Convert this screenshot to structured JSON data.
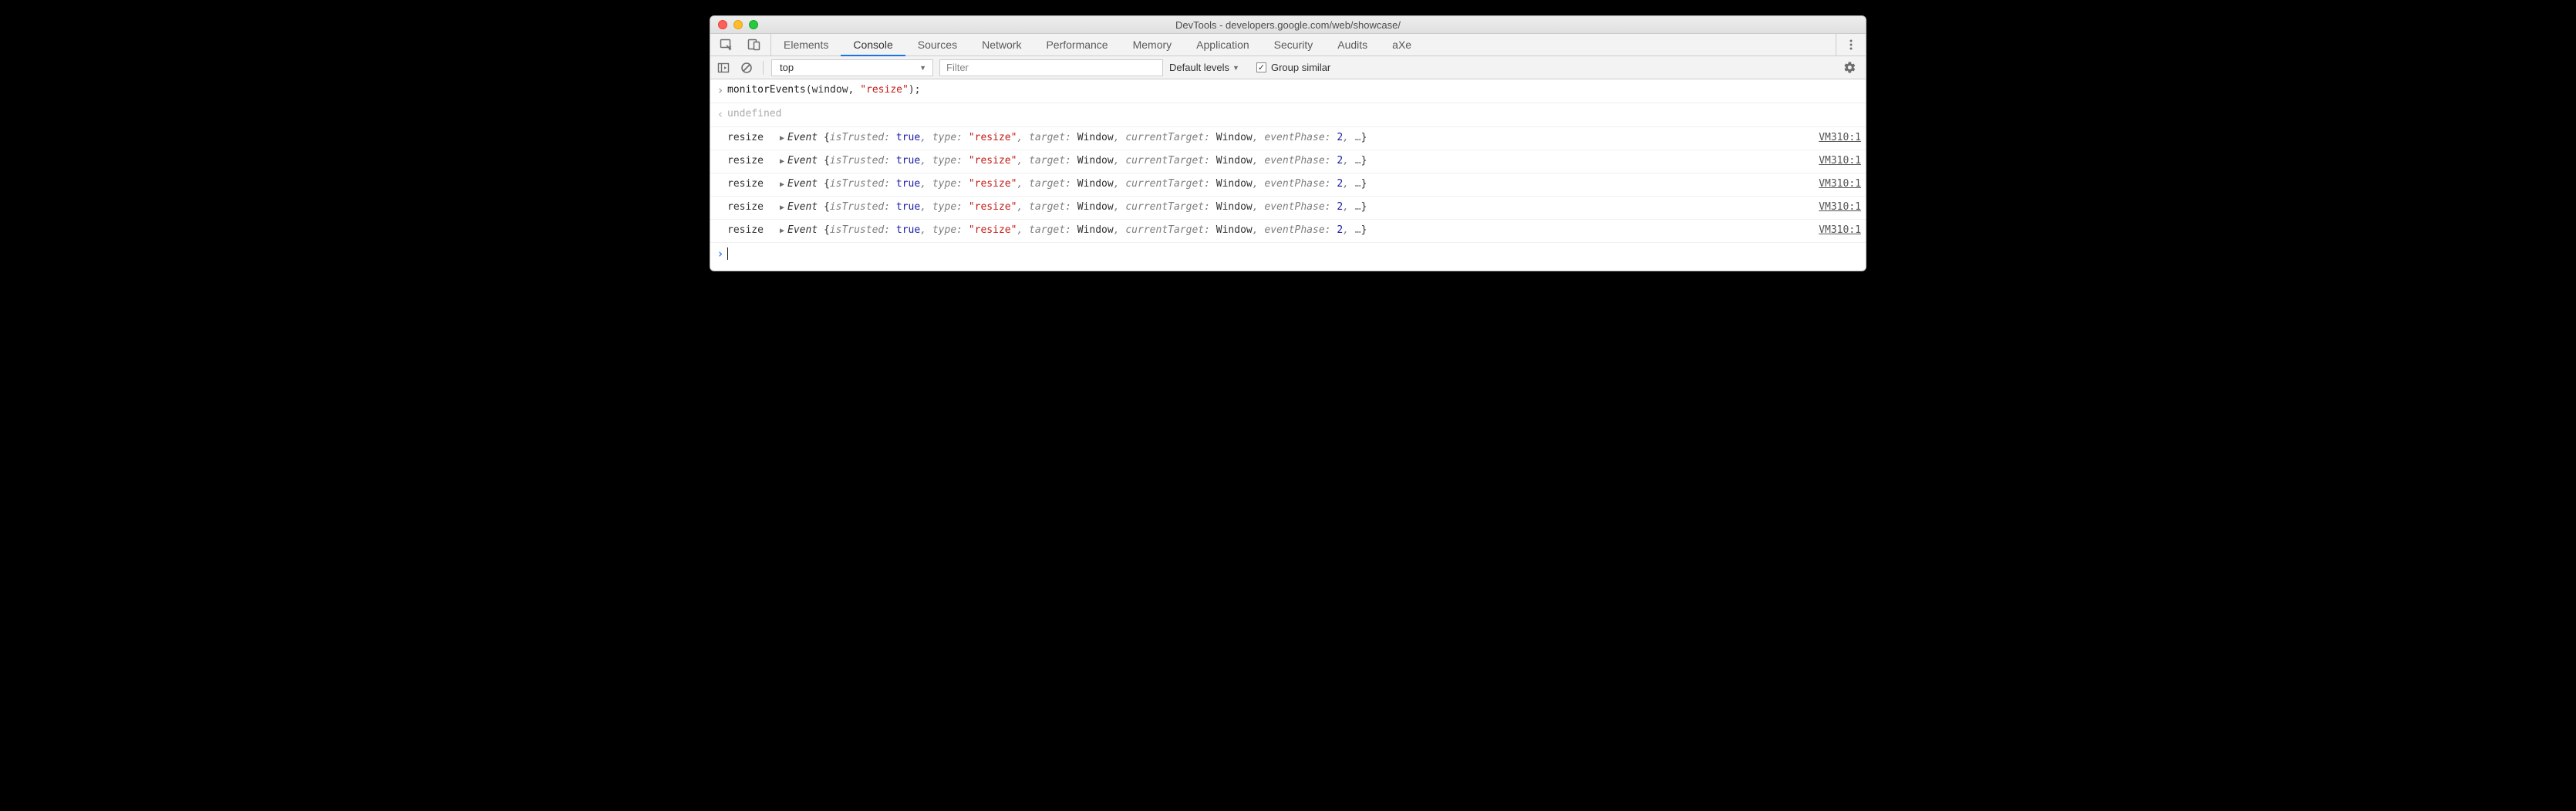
{
  "window": {
    "title": "DevTools - developers.google.com/web/showcase/"
  },
  "tabs": {
    "items": [
      {
        "label": "Elements"
      },
      {
        "label": "Console"
      },
      {
        "label": "Sources"
      },
      {
        "label": "Network"
      },
      {
        "label": "Performance"
      },
      {
        "label": "Memory"
      },
      {
        "label": "Application"
      },
      {
        "label": "Security"
      },
      {
        "label": "Audits"
      },
      {
        "label": "aXe"
      }
    ],
    "activeIndex": 1
  },
  "toolbar": {
    "context": "top",
    "filterPlaceholder": "Filter",
    "levelsLabel": "Default levels",
    "groupSimilarLabel": "Group similar",
    "groupSimilarChecked": true
  },
  "console": {
    "inputLine": {
      "fn": "monitorEvents",
      "open": "(window, ",
      "str": "\"resize\"",
      "close": ");"
    },
    "outputLine": "undefined",
    "events": [
      {
        "name": "resize",
        "objName": "Event",
        "props": {
          "isTrustedLabel": "isTrusted:",
          "isTrustedVal": "true",
          "typeLabel": "type:",
          "typeVal": "\"resize\"",
          "targetLabel": "target:",
          "targetVal": "Window",
          "curTargetLabel": "currentTarget:",
          "curTargetVal": "Window",
          "phaseLabel": "eventPhase:",
          "phaseVal": "2"
        },
        "source": "VM310:1"
      },
      {
        "name": "resize",
        "objName": "Event",
        "props": {
          "isTrustedLabel": "isTrusted:",
          "isTrustedVal": "true",
          "typeLabel": "type:",
          "typeVal": "\"resize\"",
          "targetLabel": "target:",
          "targetVal": "Window",
          "curTargetLabel": "currentTarget:",
          "curTargetVal": "Window",
          "phaseLabel": "eventPhase:",
          "phaseVal": "2"
        },
        "source": "VM310:1"
      },
      {
        "name": "resize",
        "objName": "Event",
        "props": {
          "isTrustedLabel": "isTrusted:",
          "isTrustedVal": "true",
          "typeLabel": "type:",
          "typeVal": "\"resize\"",
          "targetLabel": "target:",
          "targetVal": "Window",
          "curTargetLabel": "currentTarget:",
          "curTargetVal": "Window",
          "phaseLabel": "eventPhase:",
          "phaseVal": "2"
        },
        "source": "VM310:1"
      },
      {
        "name": "resize",
        "objName": "Event",
        "props": {
          "isTrustedLabel": "isTrusted:",
          "isTrustedVal": "true",
          "typeLabel": "type:",
          "typeVal": "\"resize\"",
          "targetLabel": "target:",
          "targetVal": "Window",
          "curTargetLabel": "currentTarget:",
          "curTargetVal": "Window",
          "phaseLabel": "eventPhase:",
          "phaseVal": "2"
        },
        "source": "VM310:1"
      },
      {
        "name": "resize",
        "objName": "Event",
        "props": {
          "isTrustedLabel": "isTrusted:",
          "isTrustedVal": "true",
          "typeLabel": "type:",
          "typeVal": "\"resize\"",
          "targetLabel": "target:",
          "targetVal": "Window",
          "curTargetLabel": "currentTarget:",
          "curTargetVal": "Window",
          "phaseLabel": "eventPhase:",
          "phaseVal": "2"
        },
        "source": "VM310:1"
      }
    ]
  }
}
